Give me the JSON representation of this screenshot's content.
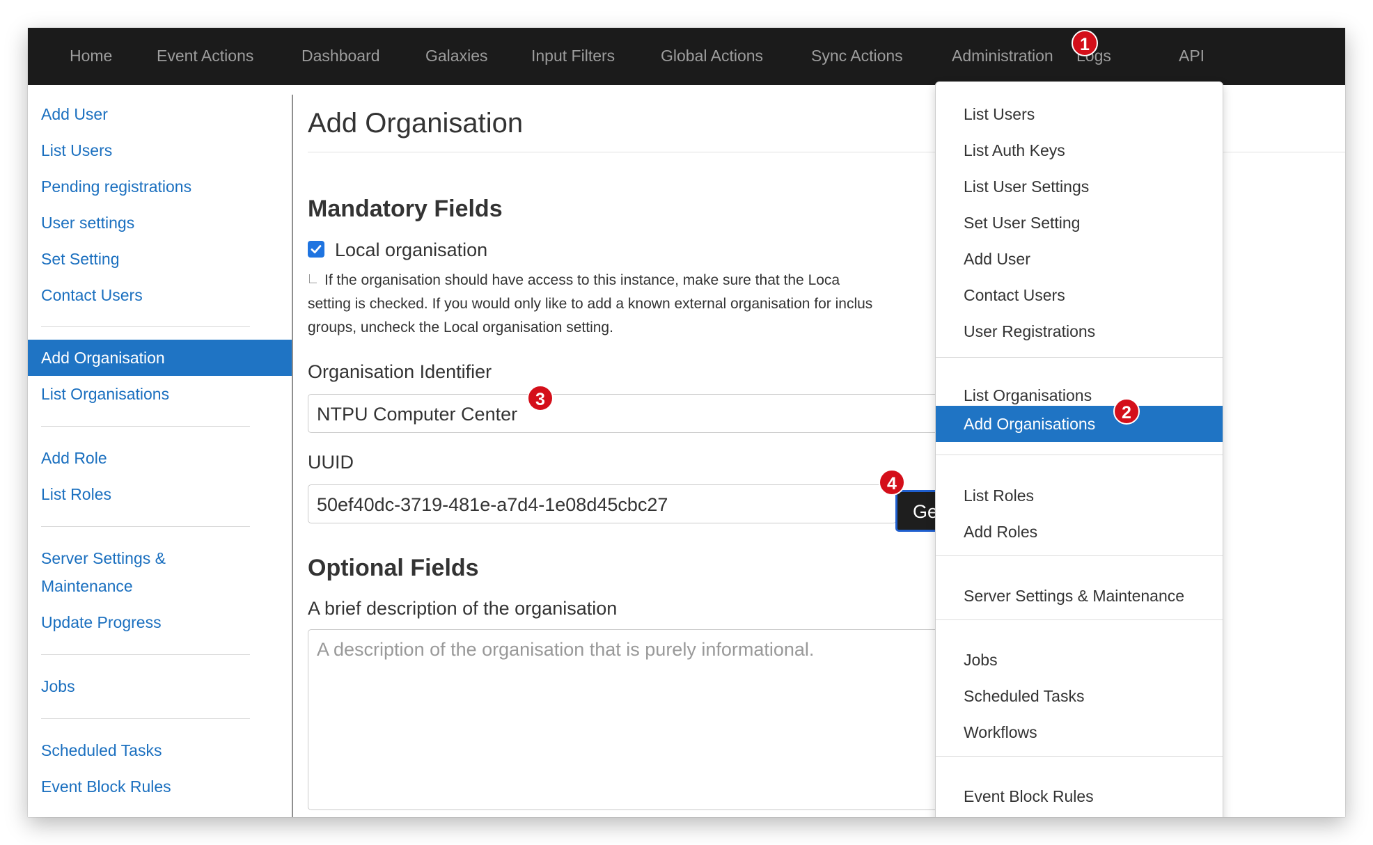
{
  "nav": {
    "items": [
      "Home",
      "Event Actions",
      "Dashboard",
      "Galaxies",
      "Input Filters",
      "Global Actions",
      "Sync Actions",
      "Administration",
      "Logs",
      "API"
    ]
  },
  "sidebar": {
    "items": [
      "Add User",
      "List Users",
      "Pending registrations",
      "User settings",
      "Set Setting",
      "Contact Users",
      "Add Organisation",
      "List Organisations",
      "Add Role",
      "List Roles",
      "Server Settings &",
      "Maintenance",
      "Update Progress",
      "Jobs",
      "Scheduled Tasks",
      "Event Block Rules"
    ]
  },
  "main": {
    "title": "Add Organisation",
    "mandatory_heading": "Mandatory Fields",
    "local_org_label": "Local organisation",
    "local_org_checked": true,
    "hint_lines": [
      "If the organisation should have access to this instance, make sure that the Loca",
      "setting is checked. If you would only like to add a known external organisation for inclus",
      "groups, uncheck the Local organisation setting."
    ],
    "org_id_label": "Organisation Identifier",
    "org_id_value": "NTPU Computer Center",
    "uuid_label": "UUID",
    "uuid_value": "50ef40dc-3719-481e-a7d4-1e08d45cbc27",
    "generate_button_label": "Ge",
    "optional_heading": "Optional Fields",
    "description_label": "A brief description of the organisation",
    "description_placeholder": "A description of the organisation that is purely informational."
  },
  "dropdown": {
    "items": [
      "List Users",
      "List Auth Keys",
      "List User Settings",
      "Set User Setting",
      "Add User",
      "Contact Users",
      "User Registrations",
      "List Organisations",
      "Add Organisations",
      "List Roles",
      "Add Roles",
      "Server Settings & Maintenance",
      "Jobs",
      "Scheduled Tasks",
      "Workflows",
      "Event Block Rules"
    ]
  },
  "markers": [
    "1",
    "2",
    "3",
    "4"
  ],
  "colors": {
    "navbar_bg": "#1b1b1b",
    "active_bg": "#1f74c4",
    "link": "#1a6fbf",
    "marker": "#d40f1a"
  }
}
